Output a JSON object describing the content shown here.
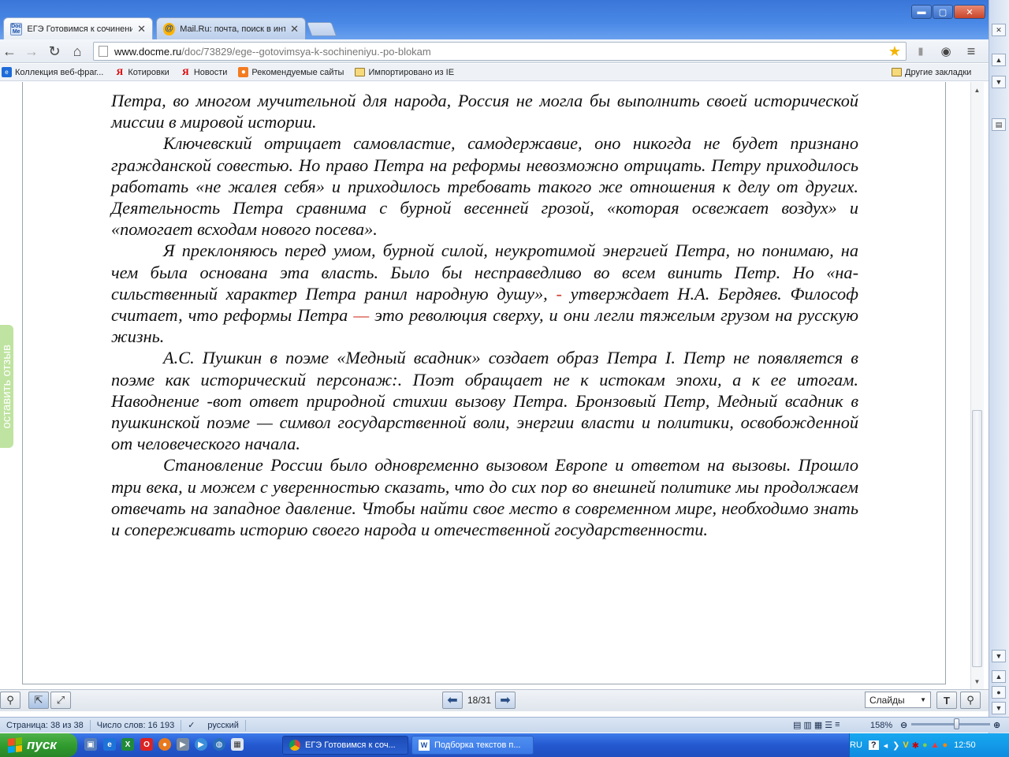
{
  "browser": {
    "tabs": [
      {
        "title": "ЕГЭ Готовимся к сочинени",
        "favicon": "docme-icon",
        "active": true
      },
      {
        "title": "Mail.Ru: почта, поиск в инт",
        "favicon": "mail-icon",
        "active": false
      }
    ],
    "url_domain": "www.docme.ru",
    "url_path": "/doc/73829/ege--gotovimsya-k-sochineniyu.-po-blokam",
    "bookmarks": [
      {
        "label": "Коллекция веб-фраг...",
        "icon": "web-icon"
      },
      {
        "label": "Котировки",
        "icon": "yandex-icon"
      },
      {
        "label": "Новости",
        "icon": "yandex-icon"
      },
      {
        "label": "Рекомендуемые сайты",
        "icon": "recommend-icon"
      },
      {
        "label": "Импортировано из IE",
        "icon": "folder-icon"
      }
    ],
    "other_bookmarks": "Другие закладки"
  },
  "document": {
    "p1": "Петра, во многом мучительной для народа, Россия не могла бы выполнить своей исторической миссии в мировой истории.",
    "p2": "Ключевский отрицает самовластие, самодержавие, оно никогда не будет признано гражданской совестью. Но право Петра на реформы невозможно отрицать. Петру приходилось работать «не жалея себя» и приходилось требовать такого же отношения к делу от других. Деятельность Петра сравнима с бурной весенней грозой, «которая освежает воздух» и «помогает всходам нового посева».",
    "p3_a": "Я преклоняюсь перед умом, бурной силой, неукротимой энергией Петра, но понимаю, на чем была основана эта власть. Было бы несправедливо во всем винить Петр. Но «на-сильственный характер Петра ранил народную душу»,",
    "p3_dash1": "-",
    "p3_b": "утверждает Н.А. Бердяев. Философ считает, что реформы Петра",
    "p3_dash2": "—",
    "p3_c": "это революция сверху, и они легли тяжелым грузом на русскую жизнь.",
    "p4": "А.С. Пушкин в поэме «Медный всадник» создает образ Петра I. Петр не появляется в поэме как исторический персонаж:. Поэт обращает не к истокам эпохи, а к ее итогам. Наводнение -вот ответ природной стихии вызову Петра. Бронзовый Петр, Медный всадник в пушкинской поэме — символ государственной воли, энергии власти и политики, освобожденной от человеческого начала.",
    "p5": "Становление России было одновременно вызовом Европе и ответом на вызовы. Прошло три века, и можем с уверенностью сказать, что до сих пор во внешней политике мы продолжаем отвечать на западное давление. Чтобы найти свое место в современном мире, необходимо знать и сопереживать историю своего народа и отечественной государственности."
  },
  "feedback_label": "оставить отзыв",
  "viewer": {
    "page_indicator": "18/31",
    "view_mode": "Слайды"
  },
  "word_status": {
    "page": "Страница: 38 из 38",
    "words": "Число слов: 16 193",
    "language": "русский",
    "zoom": "158%"
  },
  "taskbar": {
    "start_label": "пуск",
    "tasks": [
      {
        "label": "ЕГЭ Готовимся к соч...",
        "active": true
      },
      {
        "label": "Подборка текстов п...",
        "active": false
      }
    ],
    "lang": "RU",
    "clock": "12:50"
  },
  "colors": {
    "accent_red": "#d23a2a",
    "feedback_green": "#bfe3a0",
    "taskbar_blue": "#2458d0",
    "start_green": "#2f9a2d"
  }
}
